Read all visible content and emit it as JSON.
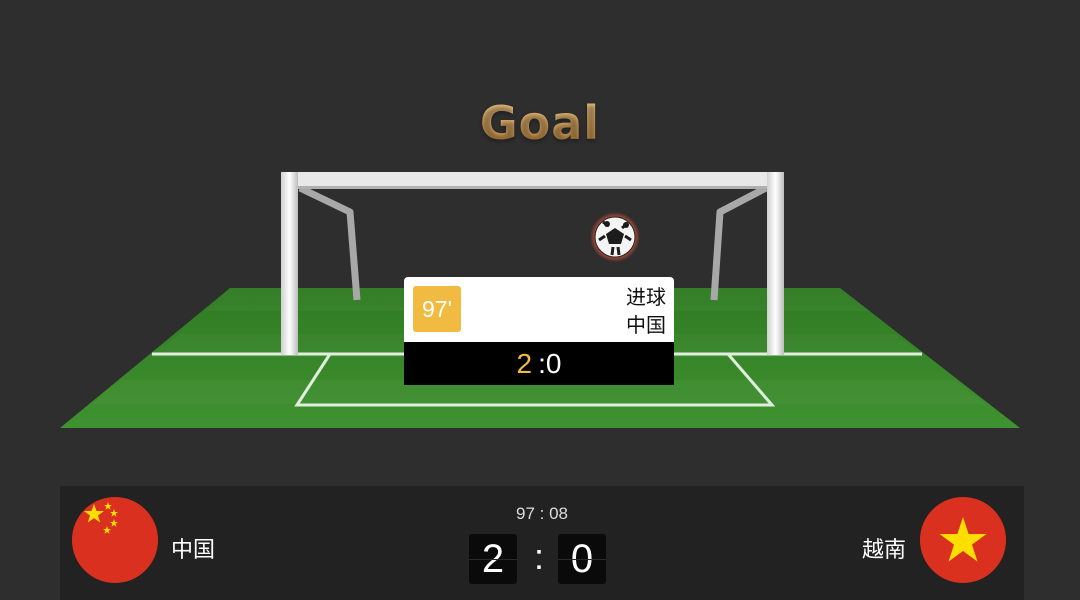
{
  "banner": {
    "title": "Goal"
  },
  "event": {
    "minute": "97'",
    "type": "进球",
    "team": "中国",
    "home_score": "2",
    "away_score": ":0"
  },
  "scoreboard": {
    "home_team": "中国",
    "away_team": "越南",
    "clock": "97 : 08",
    "home_score": "2",
    "separator": ":",
    "away_score": "0"
  },
  "colors": {
    "background": "#2e2e2e",
    "accent": "#f1bb42",
    "pitch": "#3d8a2c",
    "flag_red": "#d9301f",
    "flag_star": "#ffde00"
  },
  "icons": [
    "soccer-ball-icon",
    "goal-frame",
    "china-flag-icon",
    "vietnam-flag-icon"
  ]
}
